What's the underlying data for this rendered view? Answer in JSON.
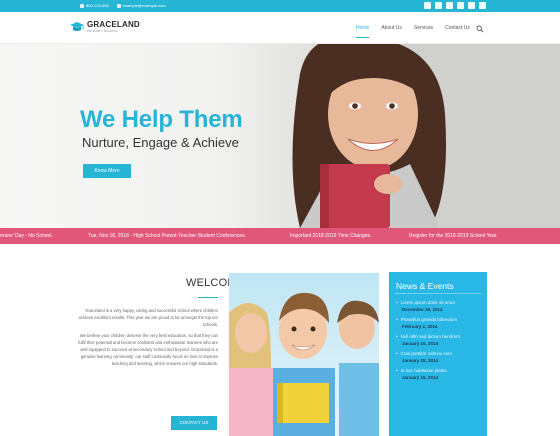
{
  "topbar": {
    "phone": "800-123-456",
    "email": "example@example.com",
    "social_icons": [
      "facebook-icon",
      "twitter-icon",
      "linkedin-icon",
      "google-plus-icon",
      "pinterest-icon",
      "youtube-icon"
    ]
  },
  "brand": {
    "name": "GRACELAND",
    "tagline": "PRIMARY SCHOOL"
  },
  "nav": {
    "items": [
      "Home",
      "About Us",
      "Services",
      "Contact Us"
    ],
    "active": "Home"
  },
  "hero": {
    "title": "We Help Them",
    "subtitle": "Nurture, Engage & Achieve",
    "button": "Know More"
  },
  "ticker": {
    "items": [
      "eterans' Day - No School.",
      "Tue, Nov 18, 2018 - High School Parent-Teacher-Student Conferences.",
      "Important 2018-2019 Time Changes.",
      "Register for the 2018-2019 School Year."
    ]
  },
  "welcome": {
    "title": "WELCOME",
    "paragraphs": [
      "Graceland is a very happy, caring and successful school where children achieve excellent results. This year we are proud to be amongst the top ten schools.",
      "We believe your children deserve the very best education, so that they can fulfil their potential and become confident and enthusiastic learners who are well equipped to succeed at secondary school and beyond. Graceland is a genuine learning community: our staff continually focus on how to improve teaching and learning, which ensures our high standards."
    ],
    "button": "CONTACT US"
  },
  "news": {
    "title": "News & Events",
    "items": [
      {
        "text": "Lorem ipsum dolor sit amet",
        "date": "December 29, 2014"
      },
      {
        "text": "Phasellus gravida bibendum",
        "date": "February 2, 2014"
      },
      {
        "text": "Nisl nibh sed dictum hendrerit",
        "date": "January 15, 2014"
      },
      {
        "text": "Cras porttitor velit eu sem",
        "date": "January 15, 2014"
      },
      {
        "text": "In hac habitasse platea",
        "date": "January 15, 2014"
      }
    ]
  },
  "colors": {
    "accent": "#27b5d6",
    "ticker": "#e05779",
    "news_bg": "#29b7e6"
  }
}
